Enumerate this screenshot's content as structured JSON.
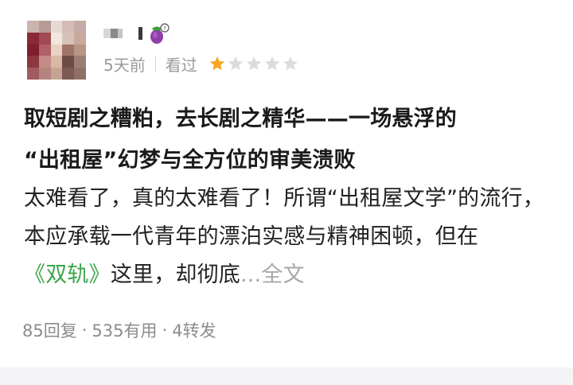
{
  "review": {
    "time_ago": "5天前",
    "seen_label": "看过",
    "rating": {
      "value": 1,
      "max": 5,
      "filled_color": "#f5a623",
      "empty_color": "#dcdcdc"
    },
    "title_line1": "取短剧之糟粕，去长剧之精华——一场悬浮的",
    "title_line2": "“出租屋”幻梦与全方位的审美溃败",
    "excerpt": {
      "text_a": "太难看了，真的太难看了！所谓“出租屋文学”的流行，本应承载一代青年的漂泊实感与精神困顿，但在",
      "book_name": "《双轨》",
      "text_b": "这里，却彻底",
      "ellipsis": "...",
      "full_text_link": "全文"
    },
    "stats": {
      "replies": "85回复",
      "sep1": "·",
      "useful": "535有用",
      "sep2": "·",
      "reposts": "4转发"
    },
    "user_badge_icon": "eggplant-icon"
  },
  "colors": {
    "book_link": "#3aa64a",
    "muted_text": "#9a9a9a",
    "star": "#f5a623"
  }
}
